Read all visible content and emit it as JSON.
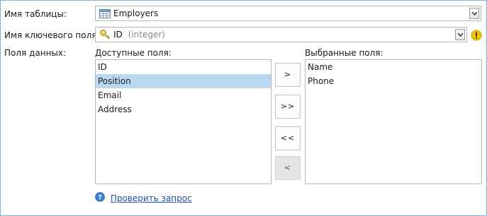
{
  "form": {
    "table_label": "Имя таблицы:",
    "table_value": "Employers",
    "key_label": "Имя ключевого поля:",
    "key_value": "ID",
    "key_type": "(integer)",
    "fields_label": "Поля данных:"
  },
  "available": {
    "title": "Доступные поля:",
    "items": [
      "ID",
      "Position",
      "Email",
      "Address"
    ],
    "selected_index": 1
  },
  "chosen": {
    "title": "Выбранные поля:",
    "items": [
      "Name",
      "Phone"
    ]
  },
  "buttons": {
    "add": ">",
    "add_all": ">>",
    "remove_all": "<<",
    "remove": "<"
  },
  "footer": {
    "check_query_link": "Проверить запрос"
  },
  "icons": {
    "table": "table-icon",
    "key": "key-icon",
    "warning": "warning-icon",
    "help": "help-icon"
  },
  "colors": {
    "selection": "#b8d9f1",
    "link": "#1f4fb0",
    "warning": "#f2c200"
  }
}
